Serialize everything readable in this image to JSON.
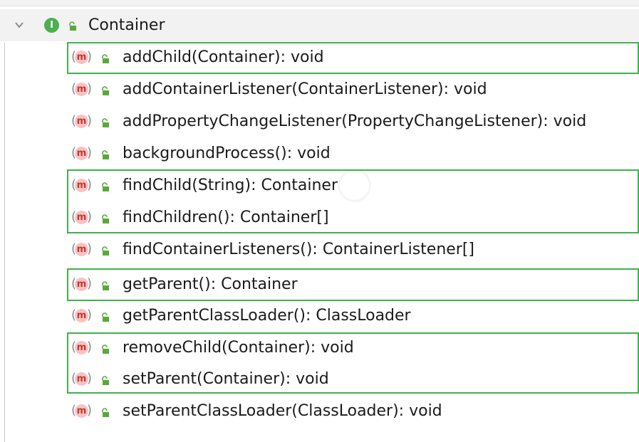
{
  "tree": {
    "root": {
      "label": "Container",
      "badge": "I"
    },
    "items": [
      {
        "label": "addChild(Container): void"
      },
      {
        "label": "addContainerListener(ContainerListener): void"
      },
      {
        "label": "addPropertyChangeListener(PropertyChangeListener): void"
      },
      {
        "label": "backgroundProcess(): void"
      },
      {
        "label": "findChild(String): Container"
      },
      {
        "label": "findChildren(): Container[]"
      },
      {
        "label": "findContainerListeners(): ContainerListener[]"
      },
      {
        "label": "getParent(): Container"
      },
      {
        "label": "getParentClassLoader(): ClassLoader"
      },
      {
        "label": "removeChild(Container): void"
      },
      {
        "label": "setParent(Container): void"
      },
      {
        "label": "setParentClassLoader(ClassLoader): void"
      }
    ],
    "method_badge": "m"
  },
  "colors": {
    "highlight_border": "#3cb44b",
    "interface_badge": "#4caf50",
    "method_badge_bg": "#f6c3c5",
    "method_badge_fg": "#c0392b",
    "lock": "#5aa83c"
  },
  "icons": {
    "root_expand": "chevron-down-icon",
    "interface": "interface-icon",
    "visibility": "lock-icon",
    "method": "method-icon"
  }
}
